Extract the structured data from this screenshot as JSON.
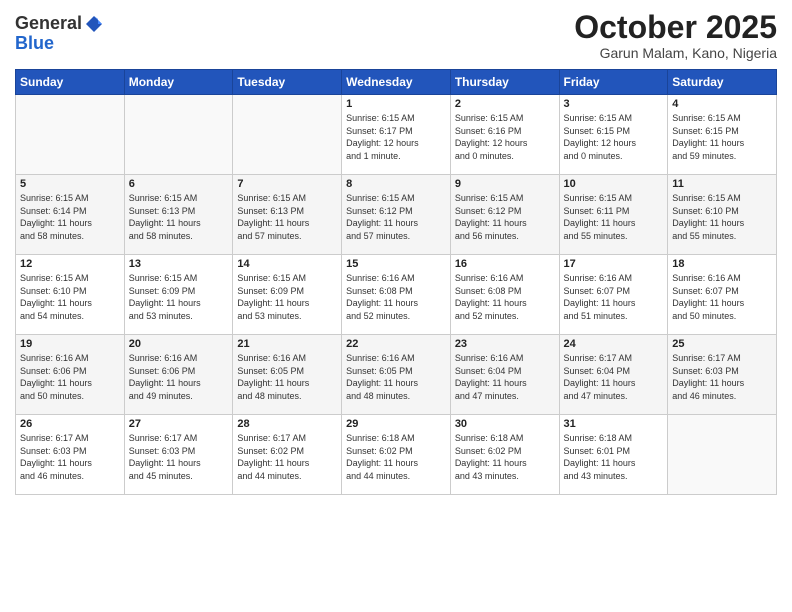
{
  "header": {
    "logo_line1": "General",
    "logo_line2": "Blue",
    "month": "October 2025",
    "location": "Garun Malam, Kano, Nigeria"
  },
  "days_of_week": [
    "Sunday",
    "Monday",
    "Tuesday",
    "Wednesday",
    "Thursday",
    "Friday",
    "Saturday"
  ],
  "weeks": [
    [
      {
        "day": "",
        "info": ""
      },
      {
        "day": "",
        "info": ""
      },
      {
        "day": "",
        "info": ""
      },
      {
        "day": "1",
        "info": "Sunrise: 6:15 AM\nSunset: 6:17 PM\nDaylight: 12 hours\nand 1 minute."
      },
      {
        "day": "2",
        "info": "Sunrise: 6:15 AM\nSunset: 6:16 PM\nDaylight: 12 hours\nand 0 minutes."
      },
      {
        "day": "3",
        "info": "Sunrise: 6:15 AM\nSunset: 6:15 PM\nDaylight: 12 hours\nand 0 minutes."
      },
      {
        "day": "4",
        "info": "Sunrise: 6:15 AM\nSunset: 6:15 PM\nDaylight: 11 hours\nand 59 minutes."
      }
    ],
    [
      {
        "day": "5",
        "info": "Sunrise: 6:15 AM\nSunset: 6:14 PM\nDaylight: 11 hours\nand 58 minutes."
      },
      {
        "day": "6",
        "info": "Sunrise: 6:15 AM\nSunset: 6:13 PM\nDaylight: 11 hours\nand 58 minutes."
      },
      {
        "day": "7",
        "info": "Sunrise: 6:15 AM\nSunset: 6:13 PM\nDaylight: 11 hours\nand 57 minutes."
      },
      {
        "day": "8",
        "info": "Sunrise: 6:15 AM\nSunset: 6:12 PM\nDaylight: 11 hours\nand 57 minutes."
      },
      {
        "day": "9",
        "info": "Sunrise: 6:15 AM\nSunset: 6:12 PM\nDaylight: 11 hours\nand 56 minutes."
      },
      {
        "day": "10",
        "info": "Sunrise: 6:15 AM\nSunset: 6:11 PM\nDaylight: 11 hours\nand 55 minutes."
      },
      {
        "day": "11",
        "info": "Sunrise: 6:15 AM\nSunset: 6:10 PM\nDaylight: 11 hours\nand 55 minutes."
      }
    ],
    [
      {
        "day": "12",
        "info": "Sunrise: 6:15 AM\nSunset: 6:10 PM\nDaylight: 11 hours\nand 54 minutes."
      },
      {
        "day": "13",
        "info": "Sunrise: 6:15 AM\nSunset: 6:09 PM\nDaylight: 11 hours\nand 53 minutes."
      },
      {
        "day": "14",
        "info": "Sunrise: 6:15 AM\nSunset: 6:09 PM\nDaylight: 11 hours\nand 53 minutes."
      },
      {
        "day": "15",
        "info": "Sunrise: 6:16 AM\nSunset: 6:08 PM\nDaylight: 11 hours\nand 52 minutes."
      },
      {
        "day": "16",
        "info": "Sunrise: 6:16 AM\nSunset: 6:08 PM\nDaylight: 11 hours\nand 52 minutes."
      },
      {
        "day": "17",
        "info": "Sunrise: 6:16 AM\nSunset: 6:07 PM\nDaylight: 11 hours\nand 51 minutes."
      },
      {
        "day": "18",
        "info": "Sunrise: 6:16 AM\nSunset: 6:07 PM\nDaylight: 11 hours\nand 50 minutes."
      }
    ],
    [
      {
        "day": "19",
        "info": "Sunrise: 6:16 AM\nSunset: 6:06 PM\nDaylight: 11 hours\nand 50 minutes."
      },
      {
        "day": "20",
        "info": "Sunrise: 6:16 AM\nSunset: 6:06 PM\nDaylight: 11 hours\nand 49 minutes."
      },
      {
        "day": "21",
        "info": "Sunrise: 6:16 AM\nSunset: 6:05 PM\nDaylight: 11 hours\nand 48 minutes."
      },
      {
        "day": "22",
        "info": "Sunrise: 6:16 AM\nSunset: 6:05 PM\nDaylight: 11 hours\nand 48 minutes."
      },
      {
        "day": "23",
        "info": "Sunrise: 6:16 AM\nSunset: 6:04 PM\nDaylight: 11 hours\nand 47 minutes."
      },
      {
        "day": "24",
        "info": "Sunrise: 6:17 AM\nSunset: 6:04 PM\nDaylight: 11 hours\nand 47 minutes."
      },
      {
        "day": "25",
        "info": "Sunrise: 6:17 AM\nSunset: 6:03 PM\nDaylight: 11 hours\nand 46 minutes."
      }
    ],
    [
      {
        "day": "26",
        "info": "Sunrise: 6:17 AM\nSunset: 6:03 PM\nDaylight: 11 hours\nand 46 minutes."
      },
      {
        "day": "27",
        "info": "Sunrise: 6:17 AM\nSunset: 6:03 PM\nDaylight: 11 hours\nand 45 minutes."
      },
      {
        "day": "28",
        "info": "Sunrise: 6:17 AM\nSunset: 6:02 PM\nDaylight: 11 hours\nand 44 minutes."
      },
      {
        "day": "29",
        "info": "Sunrise: 6:18 AM\nSunset: 6:02 PM\nDaylight: 11 hours\nand 44 minutes."
      },
      {
        "day": "30",
        "info": "Sunrise: 6:18 AM\nSunset: 6:02 PM\nDaylight: 11 hours\nand 43 minutes."
      },
      {
        "day": "31",
        "info": "Sunrise: 6:18 AM\nSunset: 6:01 PM\nDaylight: 11 hours\nand 43 minutes."
      },
      {
        "day": "",
        "info": ""
      }
    ]
  ]
}
